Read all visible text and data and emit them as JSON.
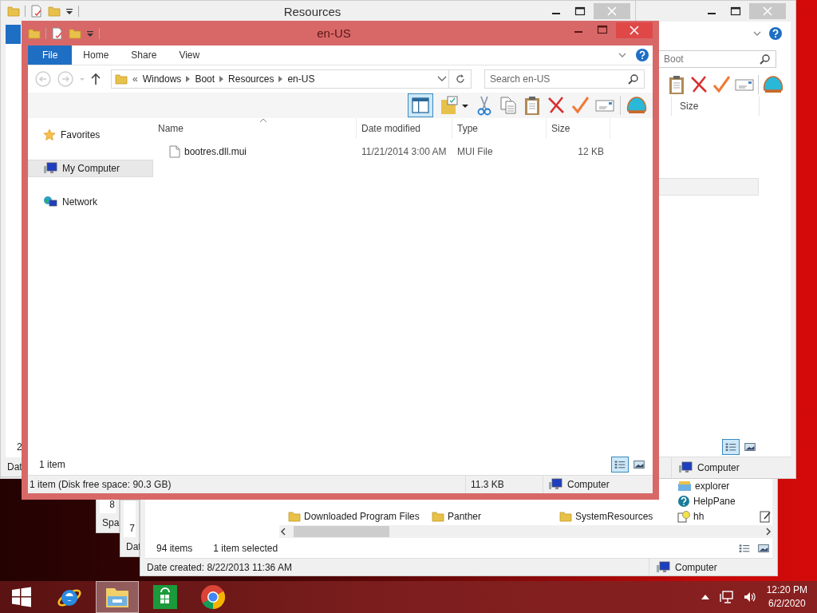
{
  "desktop": {
    "back_window": {
      "search_value": "Boot",
      "column_header": "Size",
      "location": "Computer",
      "views": [
        {
          "kind": "details",
          "selected": true
        },
        {
          "kind": "preview",
          "selected": false
        }
      ]
    },
    "resources_window": {
      "title": "Resources",
      "left_texts": [
        "2",
        "Dat"
      ]
    },
    "lower_window": {
      "columns": [
        [
          {
            "name": "Downloaded Program Files",
            "kind": "folder"
          }
        ],
        [
          {
            "name": "Panther",
            "kind": "folder"
          }
        ],
        [
          {
            "name": "SystemResources",
            "kind": "folder"
          }
        ],
        [
          {
            "name": "explorer",
            "kind": "app"
          },
          {
            "name": "HelpPane",
            "kind": "help"
          },
          {
            "name": "hh",
            "kind": "help-file"
          }
        ]
      ],
      "item_count": "94 items",
      "selection": "1 item selected",
      "details": "Date created: 8/22/2013 11:36 AM",
      "location": "Computer",
      "views": [
        {
          "kind": "details",
          "selected": false
        },
        {
          "kind": "preview",
          "selected": false
        }
      ]
    },
    "fragment_windows": [
      {
        "texts": [
          "8",
          "Spa"
        ]
      },
      {
        "texts": [
          "7",
          "Dat"
        ]
      }
    ]
  },
  "window": {
    "title": "en-US",
    "ribbon_tabs": [
      {
        "label": "File",
        "selected": true
      },
      {
        "label": "Home",
        "selected": false
      },
      {
        "label": "Share",
        "selected": false
      },
      {
        "label": "View",
        "selected": false
      }
    ],
    "address": {
      "overflow": "«",
      "path": [
        "Windows",
        "Boot",
        "Resources",
        "en-US"
      ]
    },
    "search": {
      "placeholder": "Search en-US"
    },
    "preview_pane_on": true,
    "navigation": [
      {
        "label": "Favorites",
        "kind": "favorites",
        "selected": false
      },
      {
        "label": "My Computer",
        "kind": "computer",
        "selected": true
      },
      {
        "label": "Network",
        "kind": "network",
        "selected": false
      }
    ],
    "table": {
      "columns": [
        "Name",
        "Date modified",
        "Type",
        "Size"
      ],
      "rows": [
        [
          "bootres.dll.mui",
          "11/21/2014 3:00 AM",
          "MUI File",
          "12 KB"
        ]
      ]
    },
    "item_count": "1 item",
    "views": [
      {
        "kind": "details",
        "selected": true
      },
      {
        "kind": "preview",
        "selected": false
      }
    ],
    "status_bar": {
      "summary": "1 item (Disk free space: 90.3 GB)",
      "size": "11.3 KB",
      "location": "Computer"
    }
  },
  "taskbar": {
    "apps": [
      {
        "kind": "internet-explorer",
        "active": false
      },
      {
        "kind": "file-explorer",
        "active": true
      },
      {
        "kind": "store",
        "active": false
      },
      {
        "kind": "chrome",
        "active": false
      }
    ],
    "clock": {
      "time": "12:20 PM",
      "date": "6/2/2020"
    }
  }
}
